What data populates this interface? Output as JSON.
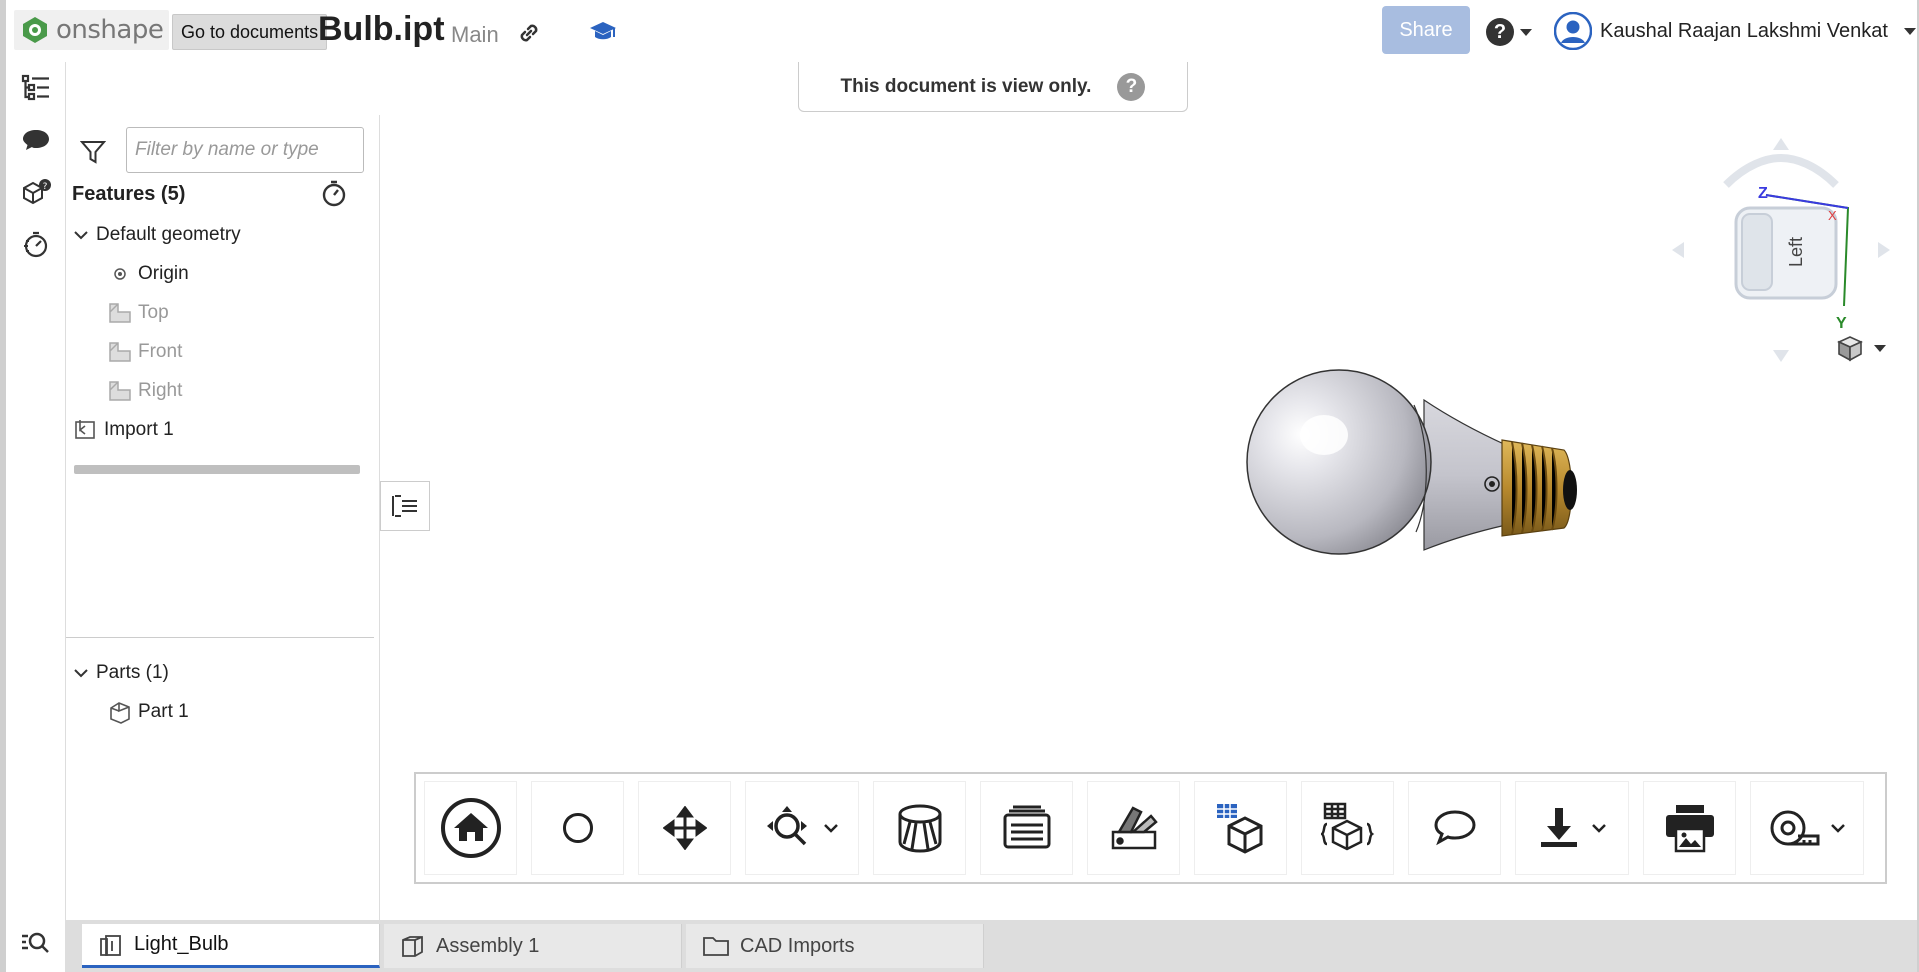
{
  "header": {
    "logo_text": "onshape",
    "goto_tooltip": "Go to documents",
    "doc_title": "Bulb.ipt",
    "branch": "Main",
    "share_label": "Share",
    "help_label": "?",
    "user_name": "Kaushal Raajan Lakshmi Venkat"
  },
  "notice": {
    "text": "This document is view only.",
    "help": "?"
  },
  "panel": {
    "filter_placeholder": "Filter by name or type",
    "features_header": "Features (5)",
    "default_geometry": "Default geometry",
    "origin": "Origin",
    "planes": [
      "Top",
      "Front",
      "Right"
    ],
    "import": "Import 1",
    "parts_header": "Parts (1)",
    "part": "Part 1"
  },
  "viewcube": {
    "face_label": "Left",
    "axes": [
      "Z",
      "X",
      "Y"
    ]
  },
  "toolbar": {
    "tools": [
      "home-icon",
      "rotate-icon",
      "pan-icon",
      "zoom-icon",
      "section-view-icon",
      "display-states-icon",
      "appearance-icon",
      "bom-icon",
      "properties-icon",
      "comment-icon",
      "export-icon",
      "print-icon",
      "measure-icon"
    ]
  },
  "tabs": [
    "Light_Bulb",
    "Assembly 1",
    "CAD Imports"
  ],
  "colors": {
    "accent": "#2b63c0",
    "share_disabled": "#a8bde0",
    "brass": "#c79a3a"
  }
}
